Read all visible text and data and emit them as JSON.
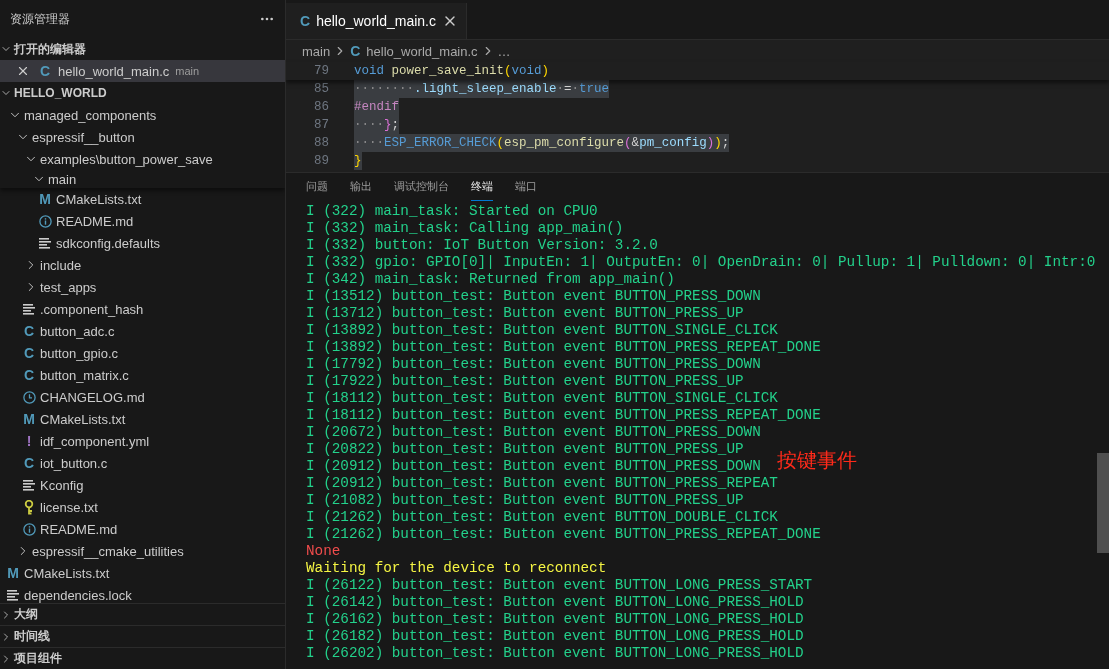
{
  "explorer": {
    "title": "资源管理器",
    "open_editors": {
      "label": "打开的编辑器",
      "expanded": true,
      "items": [
        {
          "name": "hello_world_main.c",
          "kind": "c",
          "glyph": "C",
          "description": "main",
          "selected": true
        }
      ]
    },
    "folder": {
      "label": "HELLO_WORLD",
      "expanded": true
    },
    "tree": [
      {
        "name": "managed_components",
        "kind": "folder",
        "expanded": true,
        "children": [
          {
            "name": "espressif__button",
            "kind": "folder",
            "expanded": true,
            "children": [
              {
                "name": "examples\\button_power_save",
                "kind": "folder",
                "expanded": true,
                "children": [
                  {
                    "name": "main",
                    "kind": "folder",
                    "expanded": true,
                    "children": [
                      {
                        "name": "CMakeLists.txt",
                        "kind": "cmake",
                        "glyph": "M"
                      },
                      {
                        "name": "README.md",
                        "kind": "info"
                      },
                      {
                        "name": "sdkconfig.defaults",
                        "kind": "lines"
                      }
                    ]
                  }
                ]
              },
              {
                "name": "include",
                "kind": "folder",
                "expanded": false
              },
              {
                "name": "test_apps",
                "kind": "folder",
                "expanded": false
              },
              {
                "name": ".component_hash",
                "kind": "lines"
              },
              {
                "name": "button_adc.c",
                "kind": "c",
                "glyph": "C"
              },
              {
                "name": "button_gpio.c",
                "kind": "c",
                "glyph": "C"
              },
              {
                "name": "button_matrix.c",
                "kind": "c",
                "glyph": "C"
              },
              {
                "name": "CHANGELOG.md",
                "kind": "clock"
              },
              {
                "name": "CMakeLists.txt",
                "kind": "cmake",
                "glyph": "M"
              },
              {
                "name": "idf_component.yml",
                "kind": "yml",
                "glyph": "!"
              },
              {
                "name": "iot_button.c",
                "kind": "c",
                "glyph": "C"
              },
              {
                "name": "Kconfig",
                "kind": "lines"
              },
              {
                "name": "license.txt",
                "kind": "key"
              },
              {
                "name": "README.md",
                "kind": "info"
              }
            ]
          },
          {
            "name": "espressif__cmake_utilities",
            "kind": "folder",
            "expanded": false
          }
        ]
      },
      {
        "name": "CMakeLists.txt",
        "kind": "cmake",
        "glyph": "M"
      },
      {
        "name": "dependencies.lock",
        "kind": "lines"
      }
    ],
    "sections": [
      {
        "label": "大纲",
        "expanded": false
      },
      {
        "label": "时间线",
        "expanded": false
      },
      {
        "label": "项目组件",
        "expanded": false
      }
    ]
  },
  "editor": {
    "tabs": [
      {
        "name": "hello_world_main.c",
        "kind": "c",
        "glyph": "C",
        "selected": true
      }
    ],
    "breadcrumb": [
      {
        "label": "main"
      },
      {
        "label": "hello_world_main.c",
        "kind": "c",
        "glyph": "C"
      },
      {
        "label": "…"
      }
    ],
    "sticky_line": {
      "number": "79",
      "tokens": [
        {
          "text": "void",
          "kind": "keyword"
        },
        {
          "text": " power_save_init",
          "kind": "func"
        },
        {
          "text": "(",
          "kind": "bracket1"
        },
        {
          "text": "void",
          "kind": "keyword"
        },
        {
          "text": ")",
          "kind": "bracket1"
        }
      ]
    },
    "code_lines": [
      {
        "number": "85",
        "selected": true,
        "tokens": [
          {
            "text": "········",
            "kind": "ws"
          },
          {
            "text": ".light_sleep_enable",
            "kind": "var"
          },
          {
            "text": "·",
            "kind": "ws"
          },
          {
            "text": "=",
            "kind": "plain"
          },
          {
            "text": "·",
            "kind": "ws"
          },
          {
            "text": "true",
            "kind": "keyword"
          }
        ]
      },
      {
        "number": "86",
        "selected": true,
        "tokens": [
          {
            "text": "#endif",
            "kind": "directive"
          }
        ]
      },
      {
        "number": "87",
        "selected": true,
        "tokens": [
          {
            "text": "····",
            "kind": "ws"
          },
          {
            "text": "}",
            "kind": "bracket2"
          },
          {
            "text": ";",
            "kind": "plain"
          }
        ]
      },
      {
        "number": "88",
        "selected": true,
        "tokens": [
          {
            "text": "····",
            "kind": "ws"
          },
          {
            "text": "ESP_ERROR_CHECK",
            "kind": "macro"
          },
          {
            "text": "(",
            "kind": "bracket1"
          },
          {
            "text": "esp_pm_configure",
            "kind": "func"
          },
          {
            "text": "(",
            "kind": "bracket2"
          },
          {
            "text": "&",
            "kind": "plain"
          },
          {
            "text": "pm_config",
            "kind": "var"
          },
          {
            "text": ")",
            "kind": "bracket2"
          },
          {
            "text": ")",
            "kind": "bracket1"
          },
          {
            "text": ";",
            "kind": "plain"
          }
        ]
      },
      {
        "number": "89",
        "selected": true,
        "tokens": [
          {
            "text": "}",
            "kind": "bracket1"
          }
        ]
      }
    ]
  },
  "panel": {
    "tabs": [
      {
        "label": "问题",
        "selected": false
      },
      {
        "label": "输出",
        "selected": false
      },
      {
        "label": "调试控制台",
        "selected": false
      },
      {
        "label": "终端",
        "selected": true
      },
      {
        "label": "端口",
        "selected": false
      }
    ],
    "terminal_lines": [
      {
        "text": "I (322) main_task: Started on CPU0",
        "kind": "info"
      },
      {
        "text": "I (332) main_task: Calling app_main()",
        "kind": "info"
      },
      {
        "text": "I (332) button: IoT Button Version: 3.2.0",
        "kind": "info"
      },
      {
        "text": "I (332) gpio: GPIO[0]| InputEn: 1| OutputEn: 0| OpenDrain: 0| Pullup: 1| Pulldown: 0| Intr:0",
        "kind": "info"
      },
      {
        "text": "I (342) main_task: Returned from app_main()",
        "kind": "info"
      },
      {
        "text": "I (13512) button_test: Button event BUTTON_PRESS_DOWN",
        "kind": "info"
      },
      {
        "text": "I (13712) button_test: Button event BUTTON_PRESS_UP",
        "kind": "info"
      },
      {
        "text": "I (13892) button_test: Button event BUTTON_SINGLE_CLICK",
        "kind": "info"
      },
      {
        "text": "I (13892) button_test: Button event BUTTON_PRESS_REPEAT_DONE",
        "kind": "info"
      },
      {
        "text": "I (17792) button_test: Button event BUTTON_PRESS_DOWN",
        "kind": "info"
      },
      {
        "text": "I (17922) button_test: Button event BUTTON_PRESS_UP",
        "kind": "info"
      },
      {
        "text": "I (18112) button_test: Button event BUTTON_SINGLE_CLICK",
        "kind": "info"
      },
      {
        "text": "I (18112) button_test: Button event BUTTON_PRESS_REPEAT_DONE",
        "kind": "info"
      },
      {
        "text": "I (20672) button_test: Button event BUTTON_PRESS_DOWN",
        "kind": "info"
      },
      {
        "text": "I (20822) button_test: Button event BUTTON_PRESS_UP",
        "kind": "info"
      },
      {
        "text": "I (20912) button_test: Button event BUTTON_PRESS_DOWN",
        "kind": "info"
      },
      {
        "text": "I (20912) button_test: Button event BUTTON_PRESS_REPEAT",
        "kind": "info"
      },
      {
        "text": "I (21082) button_test: Button event BUTTON_PRESS_UP",
        "kind": "info"
      },
      {
        "text": "I (21262) button_test: Button event BUTTON_DOUBLE_CLICK",
        "kind": "info"
      },
      {
        "text": "I (21262) button_test: Button event BUTTON_PRESS_REPEAT_DONE",
        "kind": "info"
      },
      {
        "text": "None",
        "kind": "error"
      },
      {
        "text": "Waiting for the device to reconnect",
        "kind": "warning"
      },
      {
        "text": "I (26122) button_test: Button event BUTTON_LONG_PRESS_START",
        "kind": "info"
      },
      {
        "text": "I (26142) button_test: Button event BUTTON_LONG_PRESS_HOLD",
        "kind": "info"
      },
      {
        "text": "I (26162) button_test: Button event BUTTON_LONG_PRESS_HOLD",
        "kind": "info"
      },
      {
        "text": "I (26182) button_test: Button event BUTTON_LONG_PRESS_HOLD",
        "kind": "info"
      },
      {
        "text": "I (26202) button_test: Button event BUTTON_LONG_PRESS_HOLD",
        "kind": "info"
      }
    ],
    "annotation": "按键事件"
  }
}
